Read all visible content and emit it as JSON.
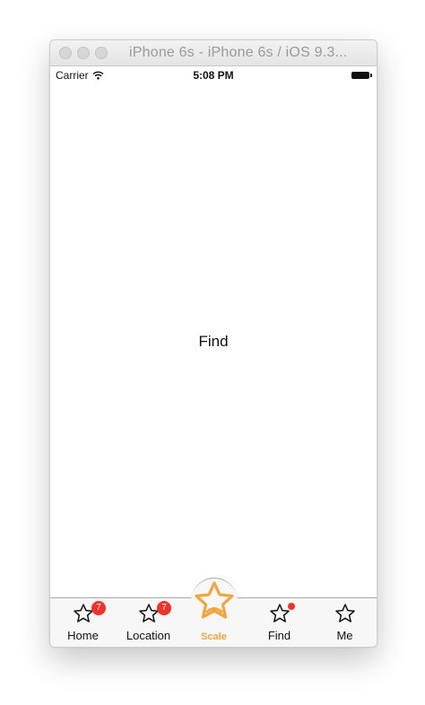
{
  "window": {
    "title": "iPhone 6s - iPhone 6s / iOS 9.3..."
  },
  "status_bar": {
    "carrier": "Carrier",
    "time": "5:08 PM",
    "icons": [
      "wifi-icon",
      "battery-icon"
    ]
  },
  "content": {
    "label": "Find"
  },
  "tab_bar": {
    "accent_color": "#f3a53c",
    "badge_color": "#f03228",
    "items": [
      {
        "label": "Home",
        "icon": "star-outline-icon",
        "badge": "7"
      },
      {
        "label": "Location",
        "icon": "star-outline-icon",
        "badge": "7"
      },
      {
        "label": "Scale",
        "icon": "star-bubble-icon",
        "selected": true
      },
      {
        "label": "Find",
        "icon": "star-outline-icon",
        "dot": true
      },
      {
        "label": "Me",
        "icon": "star-outline-icon"
      }
    ]
  }
}
